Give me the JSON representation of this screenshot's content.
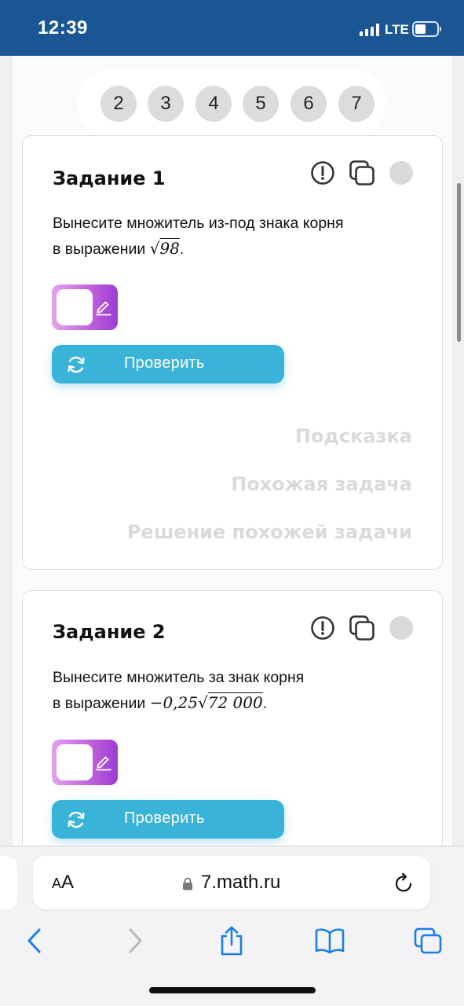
{
  "status_bar": {
    "time": "12:39",
    "network": "LTE"
  },
  "pagination": {
    "pages": [
      "2",
      "3",
      "4",
      "5",
      "6",
      "7"
    ]
  },
  "tasks": [
    {
      "title": "Задание 1",
      "text_line1": "Вынесите множитель из-под знака корня",
      "text_line2_prefix": "в выражении ",
      "math_radicand": "98",
      "math_prefix": "",
      "text_suffix": ".",
      "check_label": "Проверить",
      "links": [
        "Подсказка",
        "Похожая задача",
        "Решение похожей задачи"
      ]
    },
    {
      "title": "Задание 2",
      "text_line1": "Вынесите множитель за знак корня",
      "text_line2_prefix": "в выражении ",
      "math_prefix": "−0,25",
      "math_radicand": "72 000",
      "text_suffix": ".",
      "check_label": "Проверить"
    }
  ],
  "icons": {
    "report": "exclamation-circle-icon",
    "copy": "copy-icon",
    "status": "status-dot",
    "pencil": "pencil-icon",
    "refresh": "refresh-icon"
  },
  "browser": {
    "text_size_small": "A",
    "text_size_large": "A",
    "url": "7.math.ru"
  },
  "colors": {
    "status_bar": "#1a5594",
    "check_button": "#3ab3d9",
    "answer_gradient_start": "#e3a3ee",
    "answer_gradient_end": "#9c3bd3",
    "hint_text": "#dadada",
    "browser_icon": "#1a7ee6"
  }
}
